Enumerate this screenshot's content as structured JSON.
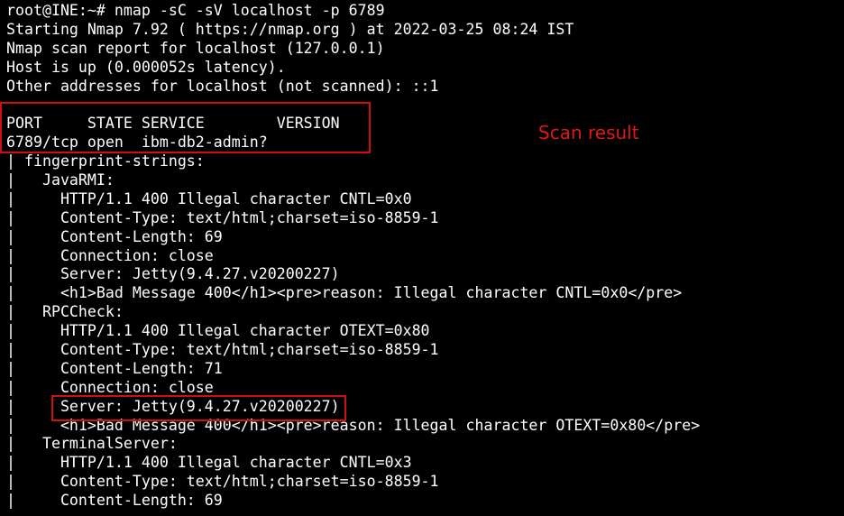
{
  "terminal": {
    "lines": [
      "root@INE:~# nmap -sC -sV localhost -p 6789",
      "Starting Nmap 7.92 ( https://nmap.org ) at 2022-03-25 08:24 IST",
      "Nmap scan report for localhost (127.0.0.1)",
      "Host is up (0.000052s latency).",
      "Other addresses for localhost (not scanned): ::1",
      "",
      "PORT     STATE SERVICE        VERSION",
      "6789/tcp open  ibm-db2-admin?",
      "| fingerprint-strings:",
      "|   JavaRMI:",
      "|     HTTP/1.1 400 Illegal character CNTL=0x0",
      "|     Content-Type: text/html;charset=iso-8859-1",
      "|     Content-Length: 69",
      "|     Connection: close",
      "|     Server: Jetty(9.4.27.v20200227)",
      "|     <h1>Bad Message 400</h1><pre>reason: Illegal character CNTL=0x0</pre>",
      "|   RPCCheck:",
      "|     HTTP/1.1 400 Illegal character OTEXT=0x80",
      "|     Content-Type: text/html;charset=iso-8859-1",
      "|     Content-Length: 71",
      "|     Connection: close",
      "|     Server: Jetty(9.4.27.v20200227)",
      "|     <h1>Bad Message 400</h1><pre>reason: Illegal character OTEXT=0x80</pre>",
      "|   TerminalServer:",
      "|     HTTP/1.1 400 Illegal character CNTL=0x3",
      "|     Content-Type: text/html;charset=iso-8859-1",
      "|     Content-Length: 69"
    ]
  },
  "annotation": {
    "label": "Scan result",
    "color": "#e01818"
  },
  "colors": {
    "background": "#000000",
    "text": "#ffffff",
    "highlight_box": "#d01010"
  }
}
